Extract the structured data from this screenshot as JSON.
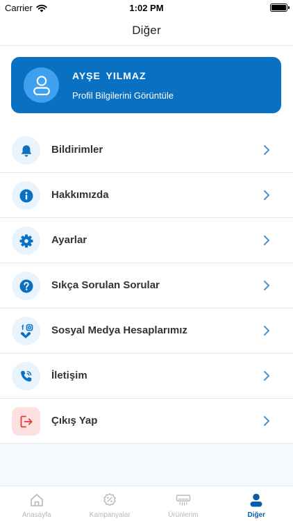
{
  "status_bar": {
    "carrier": "Carrier",
    "time": "1:02 PM"
  },
  "header": {
    "title": "Diğer"
  },
  "profile": {
    "name": "AYŞE  YILMAZ",
    "subtitle": "Profil Bilgilerini Görüntüle"
  },
  "menu": {
    "items": [
      {
        "label": "Bildirimler",
        "icon": "bell-icon"
      },
      {
        "label": "Hakkımızda",
        "icon": "info-icon"
      },
      {
        "label": "Ayarlar",
        "icon": "gear-icon"
      },
      {
        "label": "Sıkça Sorulan Sorular",
        "icon": "question-icon"
      },
      {
        "label": "Sosyal Medya Hesaplarımız",
        "icon": "social-media-icon"
      },
      {
        "label": "İletişim",
        "icon": "phone-icon"
      },
      {
        "label": "Çıkış Yap",
        "icon": "logout-icon"
      }
    ]
  },
  "tab_bar": {
    "tabs": [
      {
        "label": "Anasayfa",
        "icon": "home-icon"
      },
      {
        "label": "Kampanyalar",
        "icon": "discount-badge-icon"
      },
      {
        "label": "Ürünlerim",
        "icon": "air-conditioner-icon"
      },
      {
        "label": "Diğer",
        "icon": "user-icon",
        "active": true
      }
    ]
  },
  "colors": {
    "primary": "#0A70C2",
    "primary_light": "#3EA0EF",
    "icon_bg": "#E8F3FC",
    "danger": "#E53935",
    "danger_bg": "#FDE1E1",
    "chevron": "#4B8FCB",
    "tab_inactive": "#B3B7BD"
  }
}
